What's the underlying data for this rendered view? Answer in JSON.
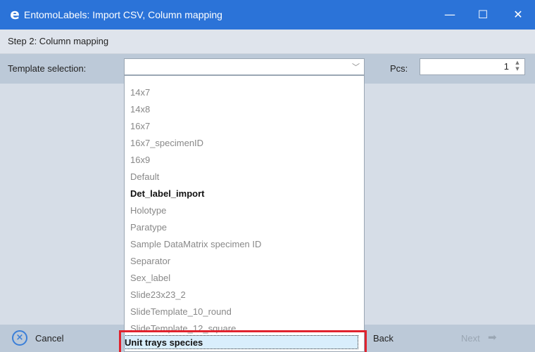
{
  "window": {
    "icon": "e",
    "title": "EntomoLabels: Import CSV, Column mapping",
    "minimize": "—",
    "maximize": "☐",
    "close": "✕"
  },
  "step": "Step 2: Column mapping",
  "toolbar": {
    "template_label": "Template selection:",
    "template_value": "",
    "pcs_label": "Pcs:",
    "pcs_value": "1"
  },
  "dropdown": {
    "options": [
      "14x7",
      "14x8",
      "16x7",
      "16x7_specimenID",
      "16x9",
      "Default",
      "Det_label_import",
      "Holotype",
      "Paratype",
      "Sample DataMatrix specimen ID",
      "Separator",
      "Sex_label",
      "Slide23x23_2",
      "SlideTemplate_10_round",
      "SlideTemplate_12_square",
      "Unit trays species"
    ],
    "bold_option": "Det_label_import",
    "selected_option": "Unit trays species"
  },
  "footer": {
    "cancel": "Cancel",
    "back": "Back",
    "next": "Next"
  },
  "colors": {
    "titlebar": "#2b73d8",
    "highlight": "#e0222d",
    "selected_bg": "#d9eefc"
  }
}
